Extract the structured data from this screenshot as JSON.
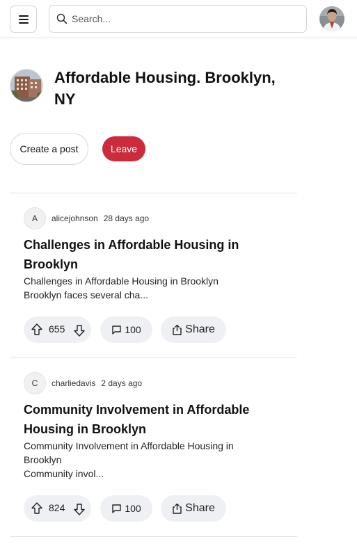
{
  "header": {
    "search_placeholder": "Search...",
    "icons": {
      "menu": "hamburger-menu-icon",
      "search": "search-icon",
      "avatar": "user-avatar-photo"
    }
  },
  "community": {
    "title": "Affordable Housing. Brooklyn, NY",
    "create_post_label": "Create a post",
    "leave_label": "Leave",
    "leave_color": "#cc2b3b"
  },
  "posts": [
    {
      "avatar_initial": "A",
      "username": "alicejohnson",
      "time": "28 days ago",
      "title": "Challenges in Affordable Housing in Brooklyn",
      "body_line1": "Challenges in Affordable Housing in Brooklyn",
      "body_line2": "Brooklyn faces several cha...",
      "votes": "655",
      "comments": "100",
      "share_label": "Share"
    },
    {
      "avatar_initial": "C",
      "username": "charliedavis",
      "time": "2 days ago",
      "title": "Community Involvement in Affordable Housing in Brooklyn",
      "body_line1": "Community Involvement in Affordable Housing in Brooklyn",
      "body_line2": "Community invol...",
      "votes": "824",
      "comments": "100",
      "share_label": "Share"
    }
  ]
}
